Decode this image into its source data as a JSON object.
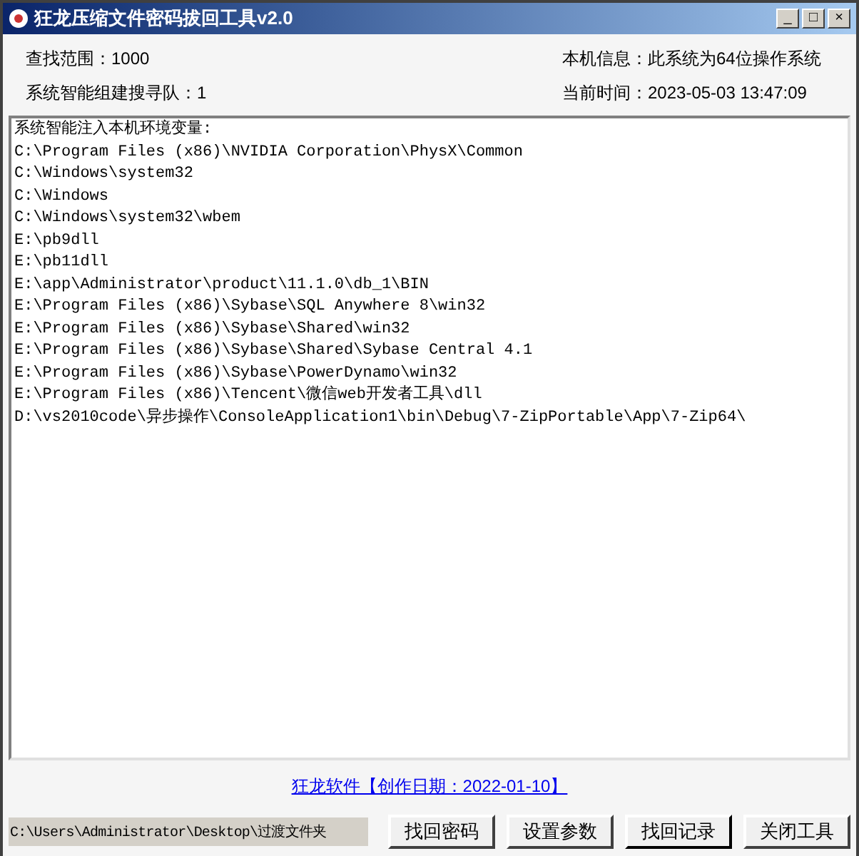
{
  "window": {
    "title": "狂龙压缩文件密码拔回工具v2.0",
    "controls": [
      "_",
      "□",
      "×"
    ]
  },
  "info": [
    {
      "label": "查找范围：",
      "value": "1000"
    },
    {
      "label": "本机信息：",
      "value": "此系统为64位操作系统"
    },
    {
      "label": "系统智能组建搜寻队：",
      "value": "1"
    },
    {
      "label": "当前时间：",
      "value": "2023-05-03 13:47:09"
    }
  ],
  "log": [
    "系统智能注入本机环境变量:",
    "C:\\Program Files (x86)\\NVIDIA Corporation\\PhysX\\Common",
    "C:\\Windows\\system32",
    "C:\\Windows",
    "C:\\Windows\\system32\\wbem",
    "E:\\pb9dll",
    "E:\\pb11dll",
    "E:\\app\\Administrator\\product\\11.1.0\\db_1\\BIN",
    "E:\\Program Files (x86)\\Sybase\\SQL Anywhere 8\\win32",
    "E:\\Program Files (x86)\\Sybase\\Shared\\win32",
    "E:\\Program Files (x86)\\Sybase\\Shared\\Sybase Central 4.1",
    "E:\\Program Files (x86)\\Sybase\\PowerDynamo\\win32",
    "E:\\Program Files (x86)\\Tencent\\微信web开发者工具\\dll",
    "D:\\vs2010code\\异步操作\\ConsoleApplication1\\bin\\Debug\\7-ZipPortable\\App\\7-Zip64\\"
  ],
  "link": "狂龙软件【创作日期：2022-01-10】",
  "path_field": {
    "value": "C:\\Users\\Administrator\\Desktop\\过渡文件夹"
  },
  "buttons": [
    {
      "label": "找回密码",
      "default": false
    },
    {
      "label": "设置参数",
      "default": false
    },
    {
      "label": "找回记录",
      "default": true
    },
    {
      "label": "关闭工具",
      "default": false
    }
  ]
}
